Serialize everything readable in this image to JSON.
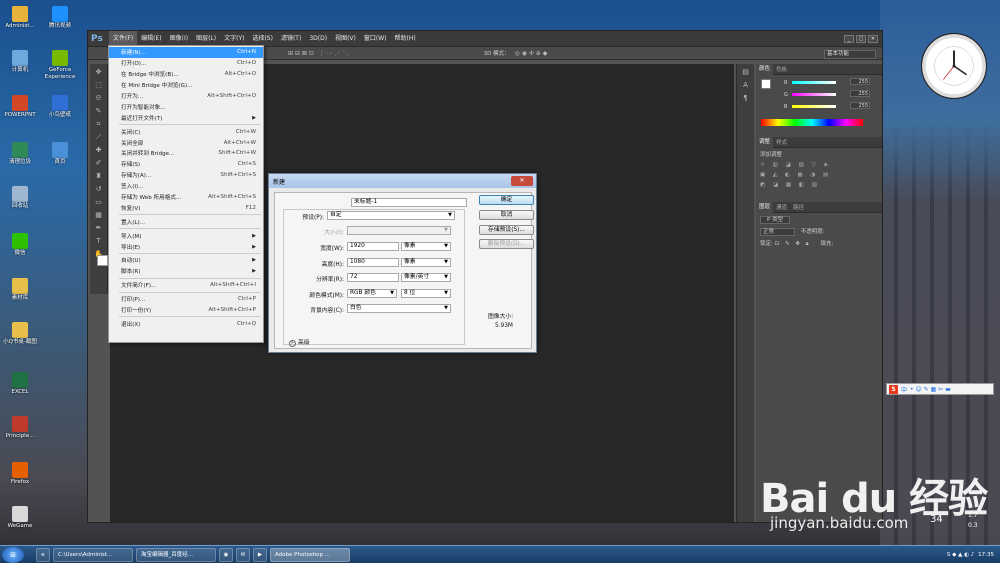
{
  "desktop": {
    "left_icons": [
      {
        "label": "Administ...",
        "color": "#e8b23a"
      },
      {
        "label": "计算机",
        "color": "#6fa8dc"
      },
      {
        "label": "POWERPNT",
        "color": "#d24726"
      },
      {
        "label": "清理垃圾",
        "color": "#2e8b57"
      },
      {
        "label": "回收站",
        "color": "#9fb8d0"
      },
      {
        "label": "微信",
        "color": "#2dc100"
      },
      {
        "label": "素材库",
        "color": "#e6c04a"
      },
      {
        "label": "小Q书桌-截图",
        "color": "#e6c04a"
      },
      {
        "label": "EXCEL",
        "color": "#1f7244"
      },
      {
        "label": "Principle...",
        "color": "#c0392b"
      },
      {
        "label": "Firefox",
        "color": "#e66000"
      },
      {
        "label": "WeGame",
        "color": "#d9d9d9"
      }
    ],
    "right_icons": [
      {
        "label": "腾讯视频",
        "color": "#1e90ff"
      },
      {
        "label": "GeForce Experience",
        "color": "#76b900"
      },
      {
        "label": "小鸟壁纸",
        "color": "#2f6fd6"
      },
      {
        "label": "首页",
        "color": "#4a90d9"
      }
    ]
  },
  "photoshop": {
    "logo": "Ps",
    "menu": [
      "文件(F)",
      "编辑(E)",
      "图像(I)",
      "图层(L)",
      "文字(Y)",
      "选择(S)",
      "滤镜(T)",
      "3D(D)",
      "视图(V)",
      "窗口(W)",
      "帮助(H)"
    ],
    "mode_3d": "3D 模式：",
    "workspace": "基本功能",
    "window_buttons": [
      "_",
      "□",
      "✕"
    ],
    "panels": {
      "color_tabs": [
        "颜色",
        "色板"
      ],
      "color_values": {
        "R": "255",
        "G": "255",
        "B": "255"
      },
      "adjust_tabs": [
        "调整",
        "样式"
      ],
      "adjust_title": "添加调整",
      "layer_tabs": [
        "图层",
        "通道",
        "路径"
      ],
      "layer_kind": "P 类型",
      "blend_mode": "正常",
      "opacity_label": "不透明度:",
      "lock_label": "锁定:",
      "fill_label": "填充:"
    }
  },
  "file_menu": [
    {
      "label": "新建(N)...",
      "shortcut": "Ctrl+N",
      "state": "highlight"
    },
    {
      "label": "打开(O)...",
      "shortcut": "Ctrl+O"
    },
    {
      "label": "在 Bridge 中浏览(B)...",
      "shortcut": "Alt+Ctrl+O"
    },
    {
      "label": "在 Mini Bridge 中浏览(G)...",
      "shortcut": ""
    },
    {
      "label": "打开为...",
      "shortcut": "Alt+Shift+Ctrl+O"
    },
    {
      "label": "打开为智能对象...",
      "shortcut": ""
    },
    {
      "label": "最近打开文件(T)",
      "shortcut": "",
      "submenu": true
    },
    {
      "sep": true
    },
    {
      "label": "关闭(C)",
      "shortcut": "Ctrl+W"
    },
    {
      "label": "关闭全部",
      "shortcut": "Alt+Ctrl+W"
    },
    {
      "label": "关闭并转到 Bridge...",
      "shortcut": "Shift+Ctrl+W"
    },
    {
      "label": "存储(S)",
      "shortcut": "Ctrl+S"
    },
    {
      "label": "存储为(A)...",
      "shortcut": "Shift+Ctrl+S"
    },
    {
      "label": "签入(I)...",
      "shortcut": ""
    },
    {
      "label": "存储为 Web 所用格式...",
      "shortcut": "Alt+Shift+Ctrl+S"
    },
    {
      "label": "恢复(V)",
      "shortcut": "F12"
    },
    {
      "sep": true
    },
    {
      "label": "置入(L)...",
      "shortcut": ""
    },
    {
      "sep": true
    },
    {
      "label": "导入(M)",
      "shortcut": "",
      "submenu": true
    },
    {
      "label": "导出(E)",
      "shortcut": "",
      "submenu": true
    },
    {
      "sep": true
    },
    {
      "label": "自动(U)",
      "shortcut": "",
      "submenu": true
    },
    {
      "label": "脚本(R)",
      "shortcut": "",
      "submenu": true
    },
    {
      "sep": true
    },
    {
      "label": "文件简介(F)...",
      "shortcut": "Alt+Shift+Ctrl+I"
    },
    {
      "sep": true
    },
    {
      "label": "打印(P)...",
      "shortcut": "Ctrl+P"
    },
    {
      "label": "打印一份(Y)",
      "shortcut": "Alt+Shift+Ctrl+P"
    },
    {
      "sep": true
    },
    {
      "label": "退出(X)",
      "shortcut": "Ctrl+Q"
    }
  ],
  "new_dialog": {
    "title": "新建",
    "name_label": "名称(N):",
    "name_value": "未标题-1",
    "preset_label": "预设(P):",
    "preset_value": "自定",
    "size_label": "大小(I):",
    "width_label": "宽度(W):",
    "width_value": "1920",
    "width_unit": "像素",
    "height_label": "高度(H):",
    "height_value": "1080",
    "height_unit": "像素",
    "resolution_label": "分辨率(R):",
    "resolution_value": "72",
    "resolution_unit": "像素/英寸",
    "color_mode_label": "颜色模式(M):",
    "color_mode_value": "RGB 颜色",
    "bit_depth": "8 位",
    "background_label": "背景内容(C):",
    "background_value": "白色",
    "advanced_label": "高级",
    "ok": "确定",
    "cancel": "取消",
    "save_preset": "存储预设(S)...",
    "delete_preset": "删除预设(D)...",
    "image_size_label": "图像大小:",
    "image_size_value": "5.93M",
    "close": "✕"
  },
  "taskbar": {
    "start": "⊞",
    "tasks": [
      "C:\\Users\\Administ...",
      "淘宝编辑器_百度经...",
      "Adobe Photoshop ..."
    ],
    "time": "17:35"
  },
  "ime": {
    "label": "中"
  },
  "net_meter": {
    "up": "1.7",
    "down": "0.3",
    "cpu": "34"
  },
  "watermark": {
    "logo": "Bai du 经验",
    "url": "jingyan.baidu.com"
  }
}
